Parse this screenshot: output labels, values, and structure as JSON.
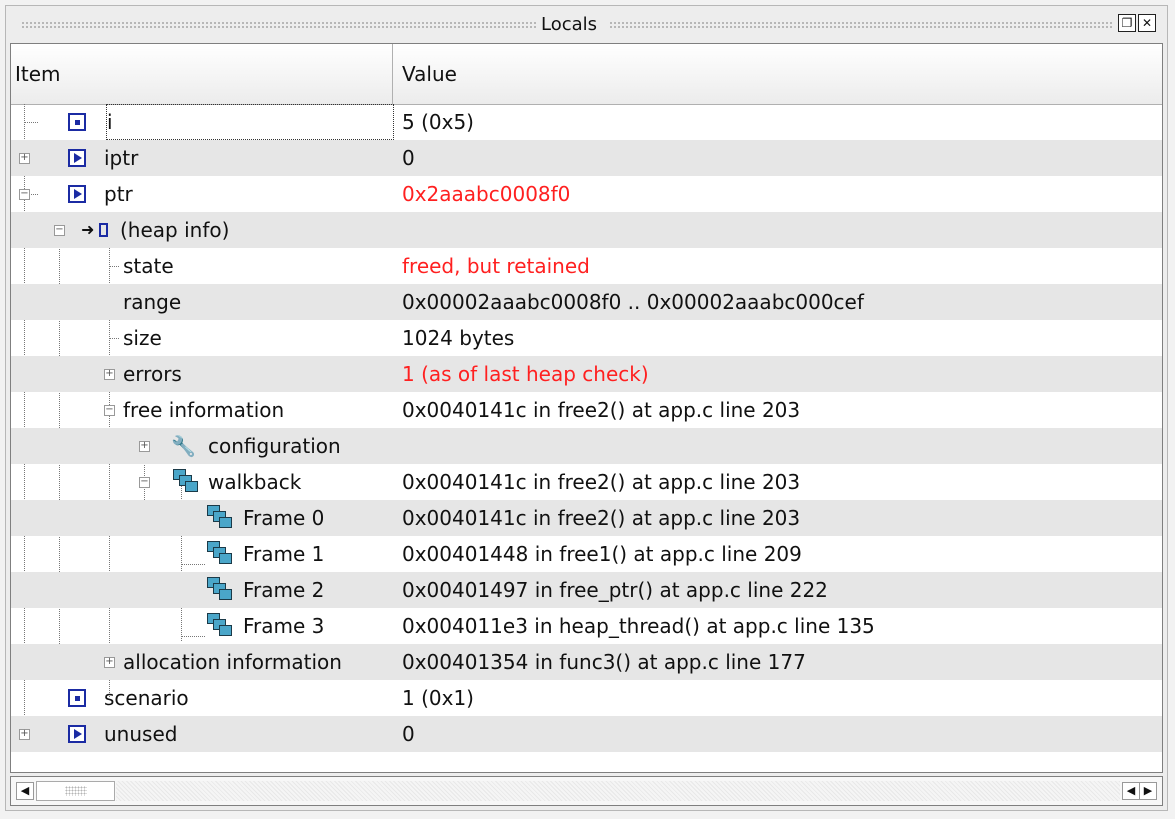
{
  "panel": {
    "title": "Locals",
    "float_icon": "restore-icon",
    "close_icon": "close-icon"
  },
  "columns": {
    "item": "Item",
    "value": "Value"
  },
  "rows": [
    {
      "label": "i",
      "value": "5 (0x5)",
      "icon": "variable-icon"
    },
    {
      "label": "iptr",
      "value": "0",
      "icon": "pointer-icon"
    },
    {
      "label": "ptr",
      "value": "0x2aaabc0008f0",
      "value_color": "#ff2020",
      "icon": "pointer-icon"
    },
    {
      "label": "(heap info)",
      "value": "",
      "icon": "heap-info-icon"
    },
    {
      "label": "state",
      "value": "freed, but retained",
      "value_color": "#ff2020"
    },
    {
      "label": "range",
      "value": "0x00002aaabc0008f0 .. 0x00002aaabc000cef"
    },
    {
      "label": "size",
      "value": "1024 bytes"
    },
    {
      "label": "errors",
      "value": "1 (as of last heap check)",
      "value_color": "#ff2020"
    },
    {
      "label": "free information",
      "value": "0x0040141c in free2() at app.c line 203"
    },
    {
      "label": "configuration",
      "value": "",
      "icon": "wrench-icon"
    },
    {
      "label": "walkback",
      "value": "0x0040141c in free2() at app.c line 203",
      "icon": "stack-icon"
    },
    {
      "label": "Frame 0",
      "value": "0x0040141c in free2() at app.c line 203",
      "icon": "stack-frame-icon"
    },
    {
      "label": "Frame 1",
      "value": "0x00401448 in free1() at app.c line 209",
      "icon": "stack-frame-icon"
    },
    {
      "label": "Frame 2",
      "value": "0x00401497 in free_ptr() at app.c line 222",
      "icon": "stack-frame-icon"
    },
    {
      "label": "Frame 3",
      "value": "0x004011e3 in heap_thread() at app.c line 135",
      "icon": "stack-frame-icon"
    },
    {
      "label": "allocation information",
      "value": "0x00401354 in func3() at app.c line 177"
    },
    {
      "label": "scenario",
      "value": "1 (0x1)",
      "icon": "variable-icon"
    },
    {
      "label": "unused",
      "value": "0",
      "icon": "pointer-icon"
    }
  ]
}
